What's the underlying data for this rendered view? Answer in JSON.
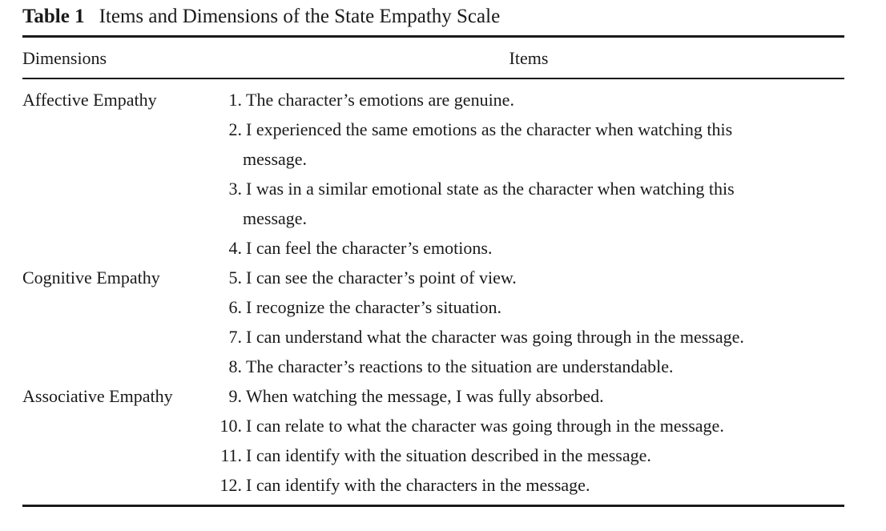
{
  "caption": {
    "label": "Table 1",
    "title": "Items and Dimensions of the State Empathy Scale"
  },
  "header": {
    "dimensions": "Dimensions",
    "items": "Items"
  },
  "groups": [
    {
      "name": "Affective Empathy"
    },
    {
      "name": "Cognitive Empathy"
    },
    {
      "name": "Associative Empathy"
    }
  ],
  "items": [
    {
      "num": "1.",
      "text": "The character’s emotions are genuine."
    },
    {
      "num": "2.",
      "text": "I experienced the same emotions as the character when watching this",
      "cont": "message."
    },
    {
      "num": "3.",
      "text": "I was in a similar emotional state as the character when watching this",
      "cont": "message."
    },
    {
      "num": "4.",
      "text": "I can feel the character’s emotions."
    },
    {
      "num": "5.",
      "text": "I can see the character’s point of view."
    },
    {
      "num": "6.",
      "text": "I recognize the character’s situation."
    },
    {
      "num": "7.",
      "text": "I can understand what the character was going through in the message."
    },
    {
      "num": "8.",
      "text": "The character’s reactions to the situation are understandable."
    },
    {
      "num": "9.",
      "text": "When watching the message, I was fully absorbed."
    },
    {
      "num": "10.",
      "text": "I can relate to what the character was going through in the message."
    },
    {
      "num": "11.",
      "text": "I can identify with the situation described in the message."
    },
    {
      "num": "12.",
      "text": "I can identify with the characters in the message."
    }
  ]
}
